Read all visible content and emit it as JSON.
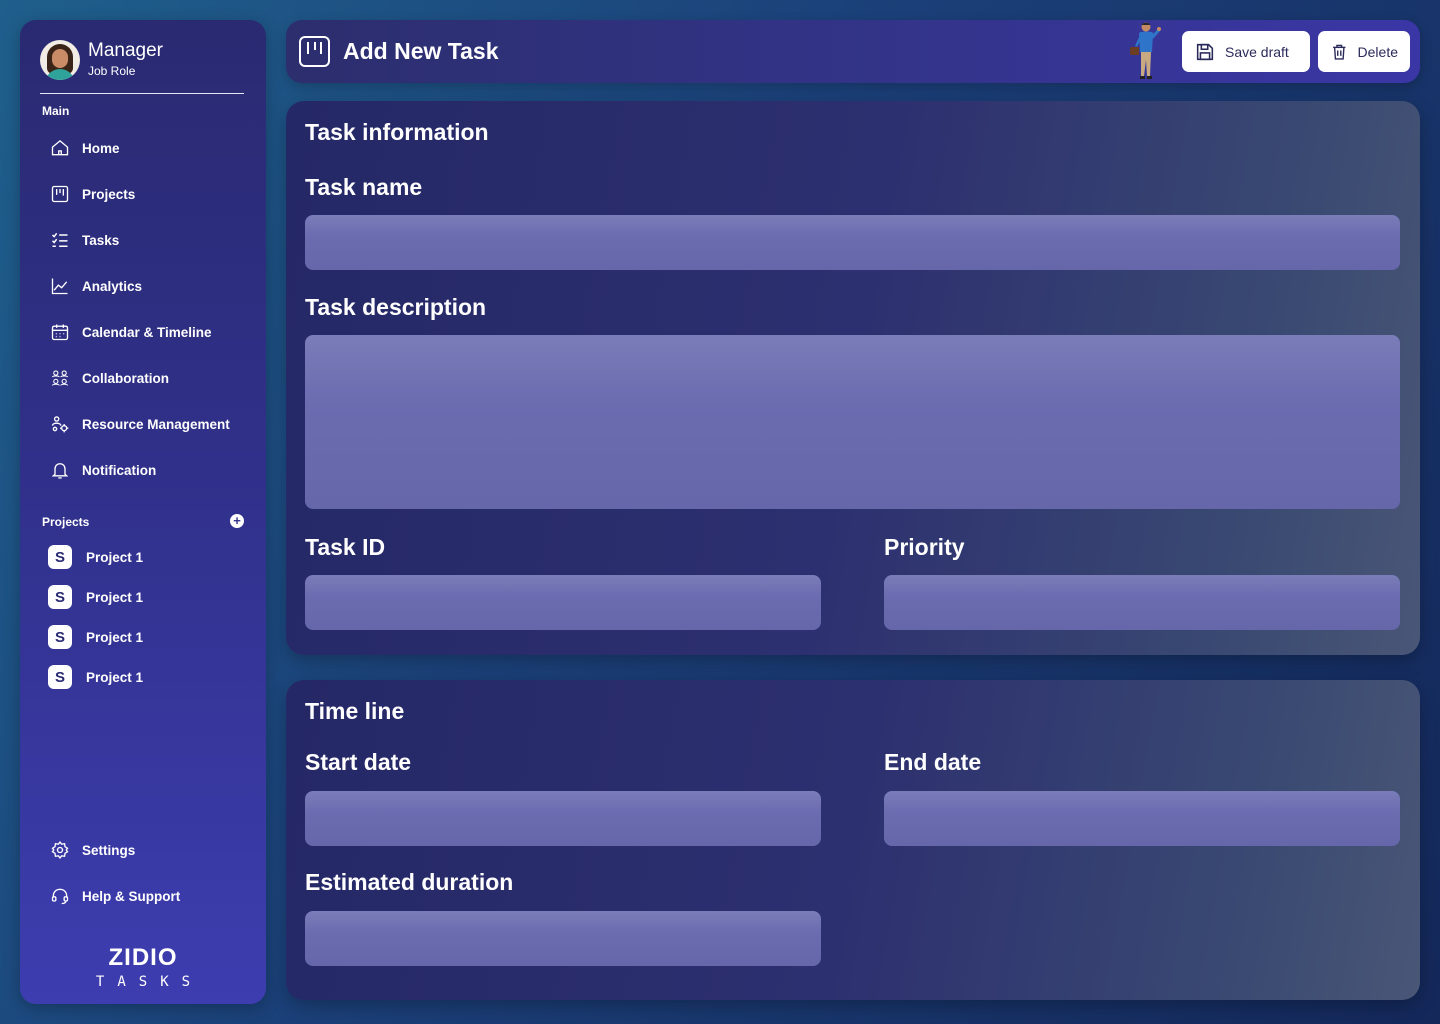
{
  "user": {
    "name": "Manager",
    "role": "Job Role"
  },
  "sidebar": {
    "main_label": "Main",
    "items": [
      {
        "label": "Home",
        "icon": "home-icon"
      },
      {
        "label": "Projects",
        "icon": "kanban-icon"
      },
      {
        "label": "Tasks",
        "icon": "task-list-icon"
      },
      {
        "label": "Analytics",
        "icon": "analytics-icon"
      },
      {
        "label": "Calendar & Timeline",
        "icon": "calendar-icon"
      },
      {
        "label": "Collaboration",
        "icon": "collaboration-icon"
      },
      {
        "label": "Resource Management",
        "icon": "resource-icon"
      },
      {
        "label": "Notification",
        "icon": "bell-icon"
      }
    ],
    "projects_label": "Projects",
    "projects": [
      {
        "label": "Project 1",
        "badge": "S"
      },
      {
        "label": "Project 1",
        "badge": "S"
      },
      {
        "label": "Project 1",
        "badge": "S"
      },
      {
        "label": "Project 1",
        "badge": "S"
      }
    ],
    "footer_items": [
      {
        "label": "Settings",
        "icon": "gear-icon"
      },
      {
        "label": "Help & Support",
        "icon": "headset-icon"
      }
    ],
    "logo": {
      "main": "ZIDIO",
      "sub": "TASKS"
    }
  },
  "header": {
    "title": "Add New Task",
    "save_label": "Save draft",
    "delete_label": "Delete"
  },
  "task_info": {
    "title": "Task information",
    "name_label": "Task name",
    "name_value": "",
    "description_label": "Task description",
    "description_value": "",
    "id_label": "Task ID",
    "id_value": "",
    "priority_label": "Priority",
    "priority_value": ""
  },
  "timeline": {
    "title": "Time line",
    "start_label": "Start date",
    "start_value": "",
    "end_label": "End date",
    "end_value": "",
    "duration_label": "Estimated duration",
    "duration_value": ""
  },
  "colors": {
    "accent": "#33348a",
    "field": "#6b6bb0",
    "background": "#1b3f78"
  }
}
